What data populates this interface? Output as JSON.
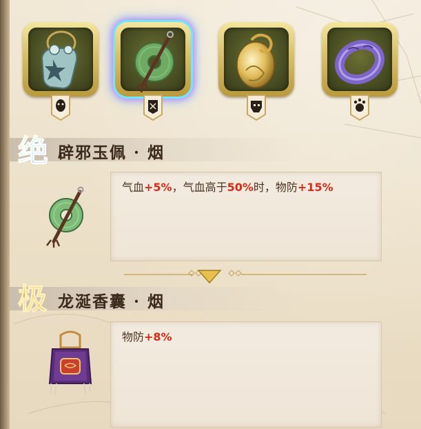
{
  "slots": [
    {
      "icon": "jade-amulet-charm-icon",
      "selected": false,
      "tag_icon": "mask-tag-icon"
    },
    {
      "icon": "jade-pendant-icon",
      "selected": true,
      "tag_icon": "guard-tag-icon"
    },
    {
      "icon": "golden-dragon-egg-icon",
      "selected": false,
      "tag_icon": "helmet-tag-icon"
    },
    {
      "icon": "purple-ring-icon",
      "selected": false,
      "tag_icon": "claw-tag-icon"
    }
  ],
  "sections": [
    {
      "badge_char": "绝",
      "badge_icon": "jue-rarity-badge-icon",
      "title": "辟邪玉佩 · 烟",
      "item_icon": "jade-pendant-icon",
      "desc": [
        {
          "text": "气血",
          "hl": false
        },
        {
          "text": "+5%",
          "hl": true
        },
        {
          "text": "，气血高于",
          "hl": false
        },
        {
          "text": "50%",
          "hl": true
        },
        {
          "text": "时，物防",
          "hl": false
        },
        {
          "text": "+15%",
          "hl": true
        }
      ]
    },
    {
      "badge_char": "极",
      "badge_icon": "ji-rarity-badge-icon",
      "title": "龙涎香囊 · 烟",
      "item_icon": "purple-sachet-icon",
      "desc": [
        {
          "text": "物防",
          "hl": false
        },
        {
          "text": "+8%",
          "hl": true
        }
      ]
    }
  ],
  "colors": {
    "highlight": "#d62b14",
    "text": "#4a3322",
    "title": "#3b2a1c",
    "selection_glow": "#6ee8ff"
  }
}
